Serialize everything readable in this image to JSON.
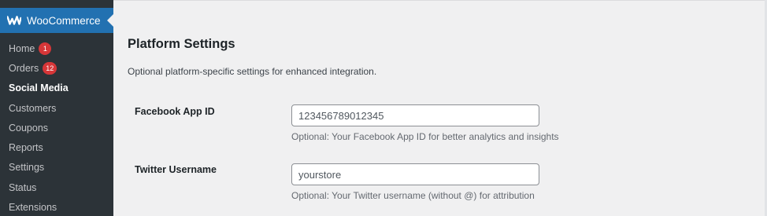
{
  "sidebar": {
    "brand": "WooCommerce",
    "items": [
      {
        "label": "Home",
        "badge": "1"
      },
      {
        "label": "Orders",
        "badge": "12"
      },
      {
        "label": "Social Media",
        "badge": null
      },
      {
        "label": "Customers",
        "badge": null
      },
      {
        "label": "Coupons",
        "badge": null
      },
      {
        "label": "Reports",
        "badge": null
      },
      {
        "label": "Settings",
        "badge": null
      },
      {
        "label": "Status",
        "badge": null
      },
      {
        "label": "Extensions",
        "badge": null
      }
    ],
    "current": "Social Media"
  },
  "main": {
    "title": "Platform Settings",
    "description": "Optional platform-specific settings for enhanced integration.",
    "fields": [
      {
        "label": "Facebook App ID",
        "value": "123456789012345",
        "help": "Optional: Your Facebook App ID for better analytics and insights"
      },
      {
        "label": "Twitter Username",
        "value": "yourstore",
        "help": "Optional: Your Twitter username (without @) for attribution"
      }
    ]
  },
  "colors": {
    "sidebar_bg": "#2c3338",
    "brand_bg": "#2271b1",
    "badge_bg": "#d63638",
    "page_bg": "#f0f0f1"
  },
  "icons": [
    "woocommerce-logo-icon"
  ]
}
